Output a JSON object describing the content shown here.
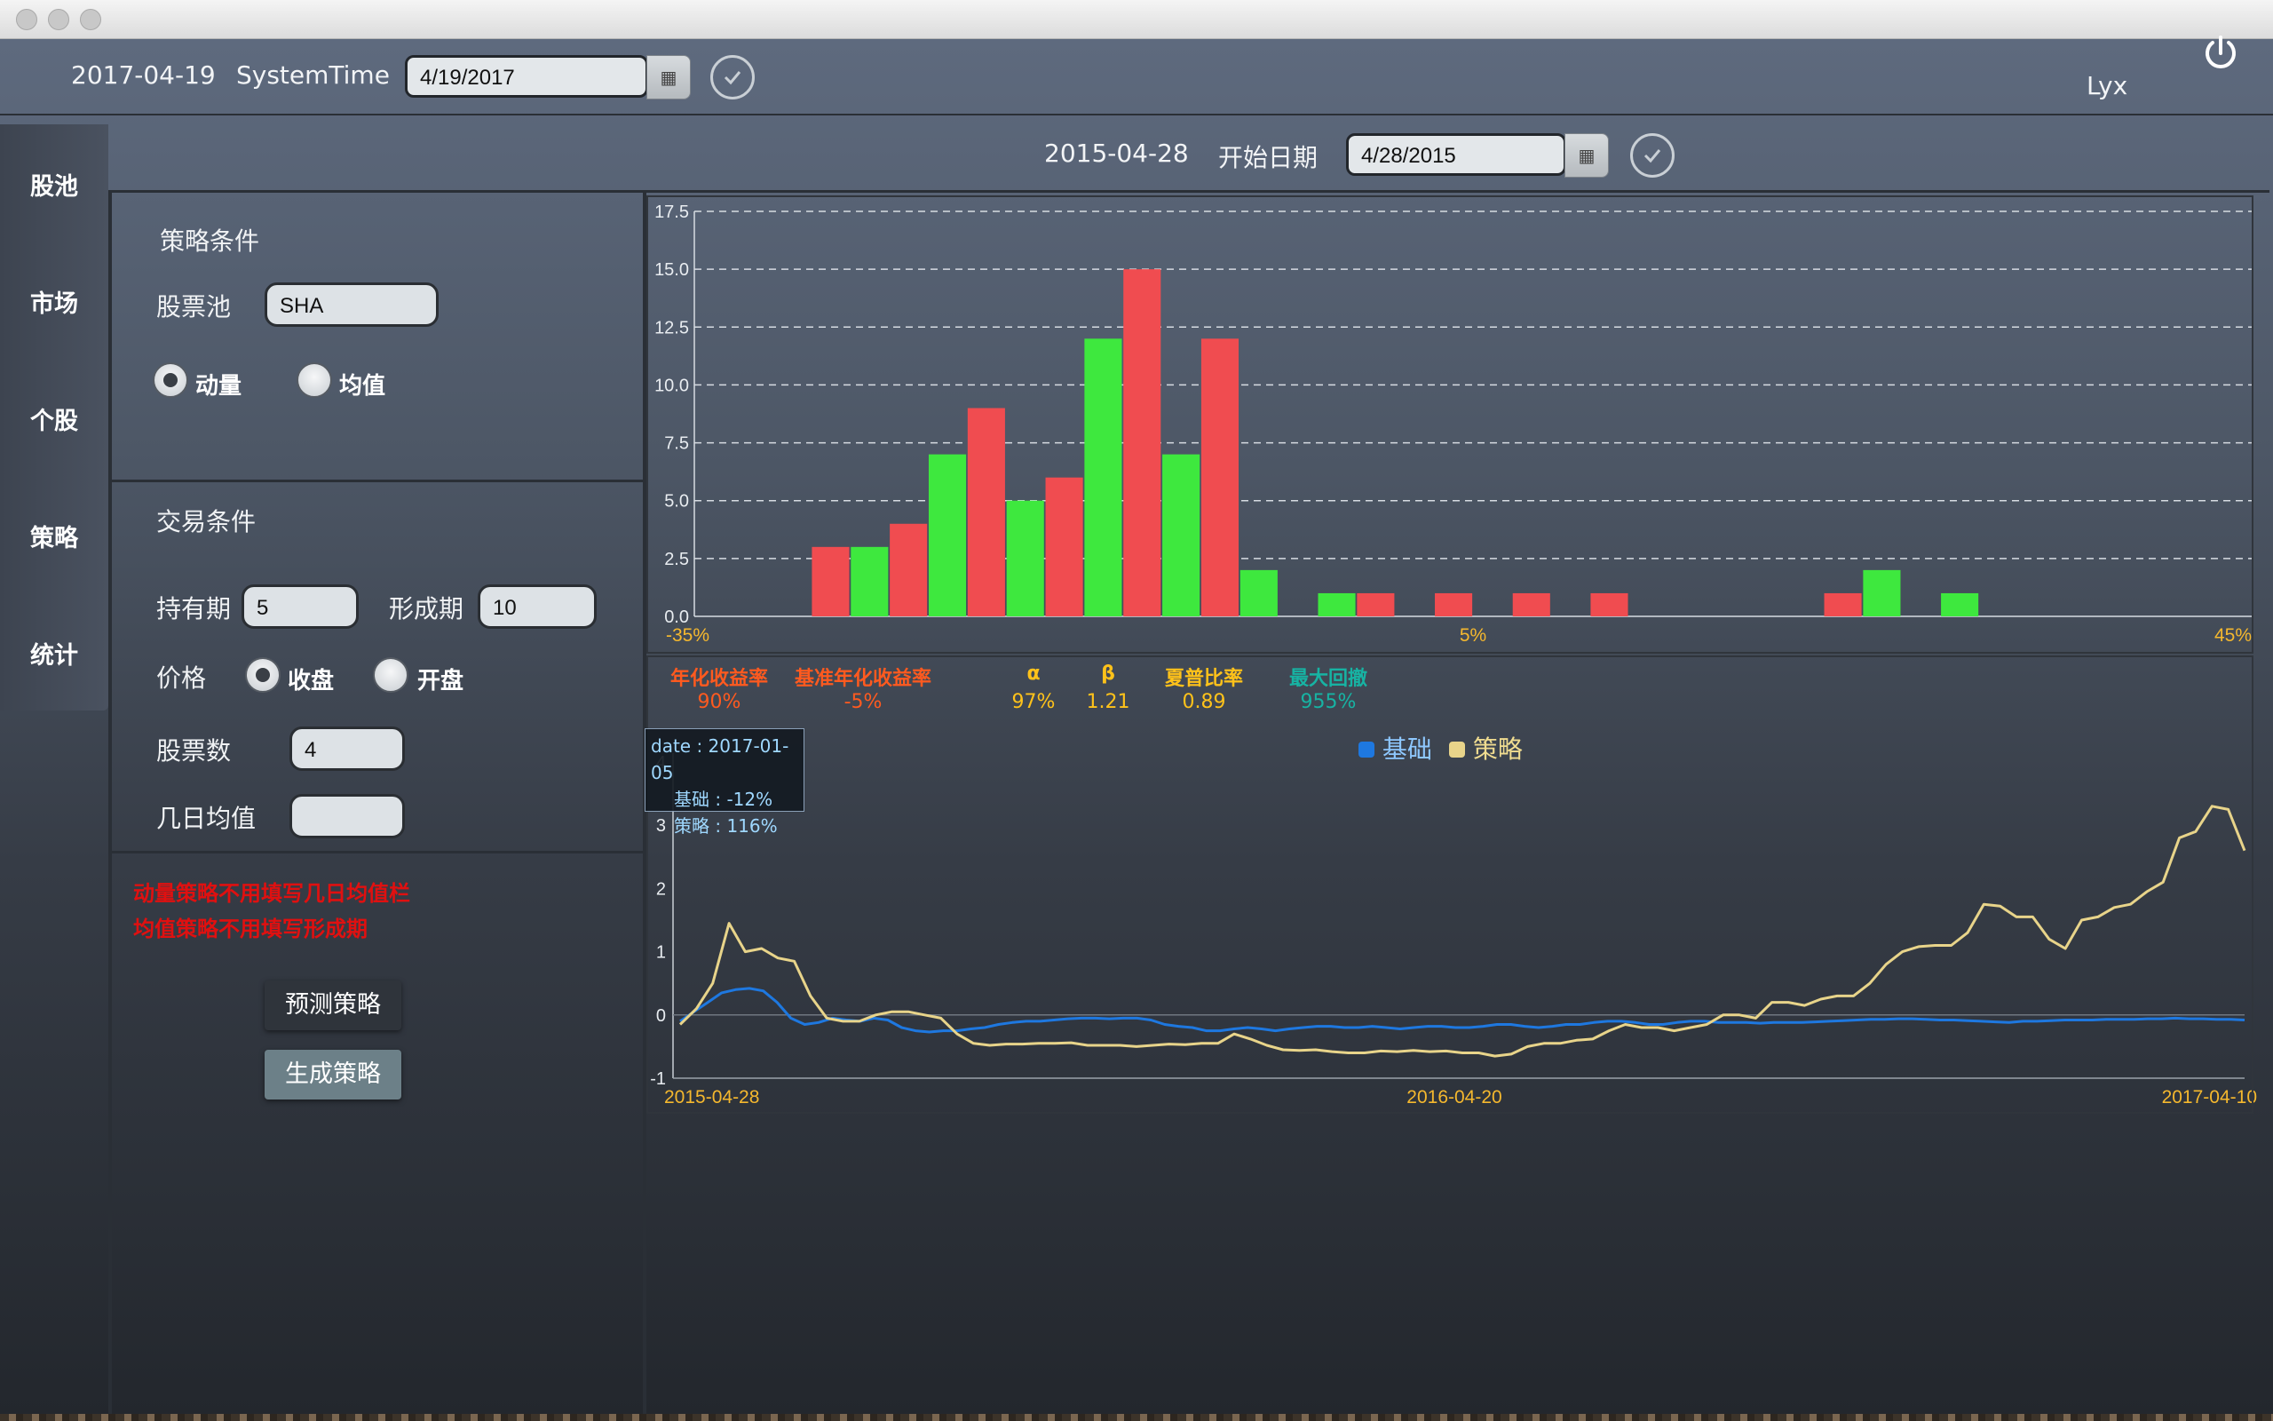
{
  "header": {
    "current_date": "2017-04-19",
    "system_time_label": "SystemTime",
    "system_time_value": "4/19/2017",
    "user": "Lyx"
  },
  "subheader": {
    "start_date_text": "2015-04-28",
    "start_date_label": "开始日期",
    "start_date_value": "4/28/2015"
  },
  "nav": {
    "items": [
      {
        "label": "股池"
      },
      {
        "label": "市场"
      },
      {
        "label": "个股"
      },
      {
        "label": "策略"
      },
      {
        "label": "统计"
      }
    ]
  },
  "strategy": {
    "title": "策略条件",
    "pool_label": "股票池",
    "pool_value": "SHA",
    "radio_momentum": "动量",
    "radio_mean": "均值",
    "selected": "动量"
  },
  "trade": {
    "title": "交易条件",
    "hold_label": "持有期",
    "hold_value": "5",
    "form_label": "形成期",
    "form_value": "10",
    "price_label": "价格",
    "price_close": "收盘",
    "price_open": "开盘",
    "price_selected": "收盘",
    "count_label": "股票数",
    "count_value": "4",
    "ma_label": "几日均值",
    "ma_value": ""
  },
  "notes": {
    "line1": "动量策略不用填写几日均值栏",
    "line2": "均值策略不用填写形成期"
  },
  "buttons": {
    "predict": "预测策略",
    "generate": "生成策略"
  },
  "stats": [
    {
      "label": "年化收益率",
      "value": "90%",
      "color": "#ff5a1f"
    },
    {
      "label": "基准年化收益率",
      "value": "-5%",
      "color": "#ff5a1f"
    },
    {
      "label": "α",
      "value": "97%",
      "color": "#ffc21a"
    },
    {
      "label": "β",
      "value": "1.21",
      "color": "#ffc21a"
    },
    {
      "label": "夏普比率",
      "value": "0.89",
      "color": "#ffc21a"
    },
    {
      "label": "最大回撤",
      "value": "955%",
      "color": "#17b3a3"
    }
  ],
  "tooltip": {
    "date": "date : 2017-01-05",
    "base": "基础 : -12%",
    "strategy": "策略 : 116%"
  },
  "colors": {
    "bar_positive": "#3ee83e",
    "bar_negative": "#f04c50",
    "base_line": "#1e78e0",
    "strategy_line": "#e8d48a",
    "axis_label": "#f5b82e"
  },
  "chart_data": [
    {
      "type": "bar",
      "xlabel": "",
      "ylabel": "",
      "ylim": [
        0,
        17.5
      ],
      "yticks": [
        "0.0",
        "2.5",
        "5.0",
        "7.5",
        "10.0",
        "12.5",
        "15.0",
        "17.5"
      ],
      "xticks": [
        "-35%",
        "5%",
        "45%"
      ],
      "x_range": [
        -35,
        45
      ],
      "grid": "horizontal-dashed",
      "bars": [
        {
          "x": -28.0,
          "value": 3,
          "color": "red"
        },
        {
          "x": -26.0,
          "value": 3,
          "color": "green"
        },
        {
          "x": -24.0,
          "value": 4,
          "color": "red"
        },
        {
          "x": -22.0,
          "value": 7,
          "color": "green"
        },
        {
          "x": -20.0,
          "value": 9,
          "color": "red"
        },
        {
          "x": -18.0,
          "value": 5,
          "color": "green"
        },
        {
          "x": -16.0,
          "value": 6,
          "color": "red"
        },
        {
          "x": -14.0,
          "value": 12,
          "color": "green"
        },
        {
          "x": -12.0,
          "value": 15,
          "color": "red"
        },
        {
          "x": -10.0,
          "value": 7,
          "color": "green"
        },
        {
          "x": -8.0,
          "value": 12,
          "color": "red"
        },
        {
          "x": -6.0,
          "value": 2,
          "color": "green"
        },
        {
          "x": -2.0,
          "value": 1,
          "color": "green"
        },
        {
          "x": 0.0,
          "value": 1,
          "color": "red"
        },
        {
          "x": 4.0,
          "value": 1,
          "color": "red"
        },
        {
          "x": 8.0,
          "value": 1,
          "color": "red"
        },
        {
          "x": 12.0,
          "value": 1,
          "color": "red"
        },
        {
          "x": 24.0,
          "value": 1,
          "color": "red"
        },
        {
          "x": 26.0,
          "value": 2,
          "color": "green"
        },
        {
          "x": 30.0,
          "value": 1,
          "color": "green"
        }
      ]
    },
    {
      "type": "line",
      "xlabel": "",
      "ylabel": "",
      "ylim": [
        -1,
        4
      ],
      "yticks": [
        "-1",
        "0",
        "1",
        "2",
        "3",
        "4"
      ],
      "xticks": [
        "2015-04-28",
        "2016-04-20",
        "2017-04-10"
      ],
      "grid": "zero-line",
      "legend_position": "top-center",
      "series": [
        {
          "name": "基础",
          "color": "#1e78e0",
          "values": [
            -0.1,
            0.05,
            0.2,
            0.35,
            0.4,
            0.42,
            0.38,
            0.2,
            -0.05,
            -0.15,
            -0.12,
            -0.05,
            -0.08,
            -0.1,
            -0.05,
            -0.08,
            -0.2,
            -0.25,
            -0.27,
            -0.25,
            -0.25,
            -0.22,
            -0.2,
            -0.15,
            -0.12,
            -0.1,
            -0.1,
            -0.08,
            -0.06,
            -0.05,
            -0.05,
            -0.06,
            -0.05,
            -0.05,
            -0.08,
            -0.15,
            -0.18,
            -0.2,
            -0.25,
            -0.25,
            -0.22,
            -0.2,
            -0.22,
            -0.25,
            -0.22,
            -0.2,
            -0.18,
            -0.18,
            -0.2,
            -0.2,
            -0.18,
            -0.2,
            -0.22,
            -0.2,
            -0.18,
            -0.18,
            -0.2,
            -0.2,
            -0.18,
            -0.15,
            -0.15,
            -0.18,
            -0.2,
            -0.18,
            -0.15,
            -0.15,
            -0.12,
            -0.1,
            -0.1,
            -0.12,
            -0.15,
            -0.15,
            -0.12,
            -0.1,
            -0.1,
            -0.12,
            -0.12,
            -0.12,
            -0.13,
            -0.12,
            -0.12,
            -0.12,
            -0.11,
            -0.1,
            -0.09,
            -0.08,
            -0.07,
            -0.07,
            -0.06,
            -0.06,
            -0.07,
            -0.08,
            -0.08,
            -0.09,
            -0.1,
            -0.11,
            -0.12,
            -0.1,
            -0.1,
            -0.09,
            -0.08,
            -0.08,
            -0.08,
            -0.07,
            -0.07,
            -0.07,
            -0.06,
            -0.06,
            -0.05,
            -0.06,
            -0.06,
            -0.07,
            -0.07,
            -0.08
          ]
        },
        {
          "name": "策略",
          "color": "#e8d48a",
          "values": [
            -0.15,
            0.1,
            0.5,
            1.45,
            1.0,
            1.05,
            0.9,
            0.85,
            0.3,
            -0.05,
            -0.1,
            -0.1,
            0.0,
            0.05,
            0.05,
            0.0,
            -0.05,
            -0.3,
            -0.45,
            -0.48,
            -0.46,
            -0.46,
            -0.45,
            -0.45,
            -0.44,
            -0.48,
            -0.48,
            -0.48,
            -0.5,
            -0.48,
            -0.46,
            -0.47,
            -0.45,
            -0.45,
            -0.3,
            -0.38,
            -0.48,
            -0.55,
            -0.56,
            -0.55,
            -0.58,
            -0.6,
            -0.6,
            -0.57,
            -0.58,
            -0.56,
            -0.58,
            -0.57,
            -0.6,
            -0.6,
            -0.65,
            -0.62,
            -0.5,
            -0.45,
            -0.45,
            -0.4,
            -0.38,
            -0.25,
            -0.15,
            -0.2,
            -0.2,
            -0.25,
            -0.2,
            -0.15,
            0.0,
            0.0,
            -0.05,
            0.2,
            0.2,
            0.15,
            0.25,
            0.3,
            0.3,
            0.5,
            0.8,
            1.0,
            1.08,
            1.1,
            1.1,
            1.3,
            1.75,
            1.72,
            1.55,
            1.55,
            1.2,
            1.05,
            1.5,
            1.55,
            1.7,
            1.75,
            1.95,
            2.1,
            2.8,
            2.9,
            3.3,
            3.25,
            2.6
          ]
        }
      ]
    }
  ]
}
